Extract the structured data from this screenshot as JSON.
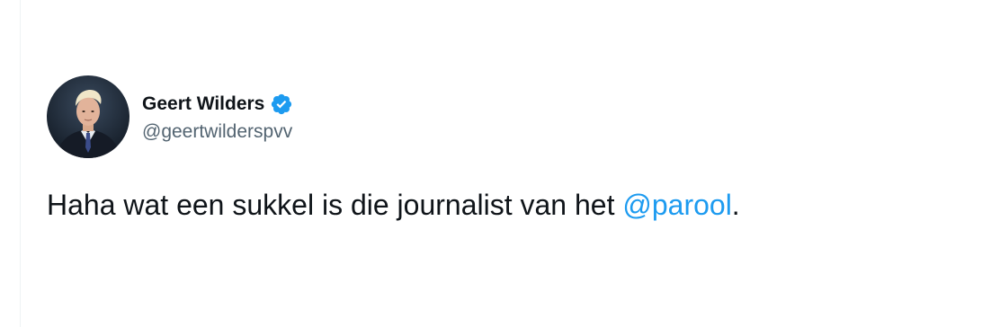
{
  "author": {
    "display_name": "Geert Wilders",
    "handle": "@geertwilderspvv",
    "verified": true,
    "verified_icon": "verified-badge-icon",
    "avatar_icon": "profile-photo"
  },
  "tweet": {
    "text_before": "Haha wat een sukkel is die journalist van het ",
    "mention": "@parool",
    "text_after": "."
  },
  "colors": {
    "text": "#0f1419",
    "secondary": "#536471",
    "link": "#1d9bf0",
    "badge": "#1d9bf0"
  }
}
